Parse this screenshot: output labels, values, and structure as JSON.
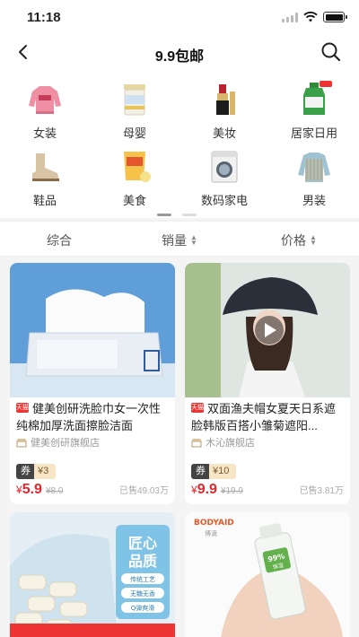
{
  "status": {
    "time": "11:18"
  },
  "nav": {
    "title": "9.9包邮"
  },
  "categories": [
    {
      "label": "女装",
      "icon": "sweatshirt-icon"
    },
    {
      "label": "母婴",
      "icon": "milk-powder-icon"
    },
    {
      "label": "美妆",
      "icon": "lipstick-icon"
    },
    {
      "label": "居家日用",
      "icon": "detergent-bottle-icon"
    },
    {
      "label": "鞋品",
      "icon": "boot-icon"
    },
    {
      "label": "美食",
      "icon": "snack-bag-icon"
    },
    {
      "label": "数码家电",
      "icon": "washing-machine-icon"
    },
    {
      "label": "男装",
      "icon": "sweater-icon"
    }
  ],
  "sort": {
    "general": "综合",
    "sales": "销量",
    "price": "价格"
  },
  "products": [
    {
      "badge": "天猫",
      "title": "健美创研洗脸巾女一次性纯棉加厚洗面擦脸洁面",
      "shop": "健美创研旗舰店",
      "coupon_label": "券",
      "coupon_value": "¥3",
      "currency": "¥",
      "price": "5.9",
      "original_price": "¥8.0",
      "sold": "已售49.03万"
    },
    {
      "badge": "天猫",
      "title": "双面渔夫帽女夏天日系遮脸韩版百搭小雏菊遮阳...",
      "shop": "木沁旗舰店",
      "coupon_label": "券",
      "coupon_value": "¥10",
      "currency": "¥",
      "price": "9.9",
      "original_price": "¥19.9",
      "sold": "已售3.81万"
    }
  ],
  "bottom_cards": [
    {
      "art_text": [
        "匠心",
        "品质"
      ],
      "tags": [
        "传统工艺",
        "无糖无香",
        "Q弹爽滑"
      ]
    },
    {
      "brand": "BODYAID",
      "brand_cn": "博滴",
      "bottle_text": [
        "99%",
        "保湿"
      ]
    }
  ],
  "colors": {
    "price": "#e3242b",
    "accent": "#e33333"
  }
}
